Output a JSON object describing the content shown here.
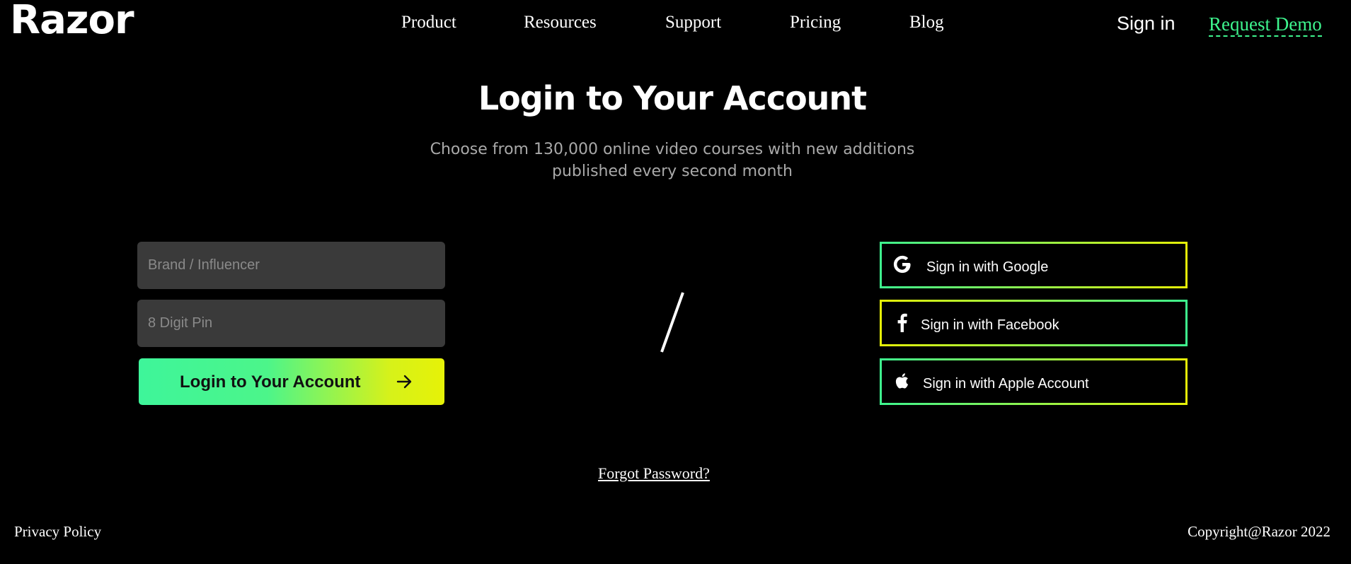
{
  "brand": {
    "logo_text": "Razor"
  },
  "nav": {
    "items": [
      {
        "label": "Product"
      },
      {
        "label": "Resources"
      },
      {
        "label": "Support"
      },
      {
        "label": "Pricing"
      },
      {
        "label": "Blog"
      }
    ],
    "sign_in_label": "Sign in",
    "request_demo_label": "Request Demo"
  },
  "hero": {
    "title": "Login to Your Account",
    "subtitle_line1": "Choose from 130,000 online video courses with new additions",
    "subtitle_line2": "published every second month"
  },
  "form": {
    "user_field": {
      "placeholder": "Brand / Influencer",
      "value": ""
    },
    "pin_field": {
      "placeholder": "8 Digit Pin",
      "value": ""
    },
    "submit_label": "Login to Your Account",
    "submit_icon": "arrow-right-icon",
    "divider_text": "/"
  },
  "social": [
    {
      "label": "Sign in with Google",
      "icon": "google-icon"
    },
    {
      "label": "Sign in with Facebook",
      "icon": "facebook-icon"
    },
    {
      "label": "Sign in with Apple Account",
      "icon": "apple-icon"
    }
  ],
  "forgot_label": "Forgot Password?",
  "footer": {
    "privacy_label": "Privacy Policy",
    "copyright": "Copyright@Razor 2022"
  },
  "colors": {
    "background": "#000000",
    "accent_green": "#3ef58e",
    "accent_yellow": "#e6f207",
    "field_bg": "#3a3a3a"
  }
}
